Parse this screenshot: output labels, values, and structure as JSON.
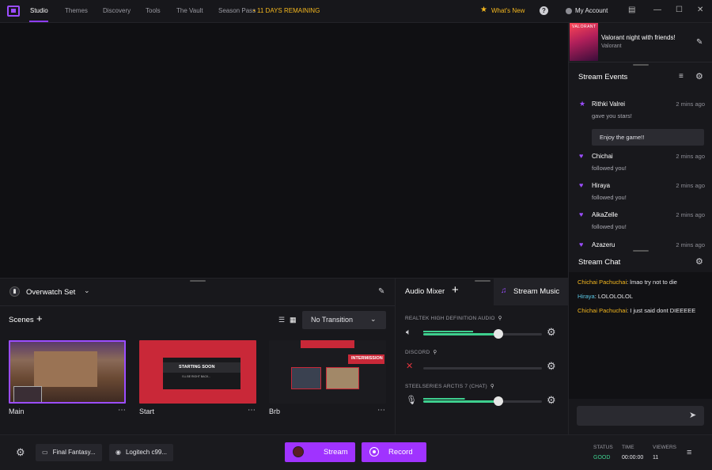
{
  "topbar": {
    "tabs": [
      "Studio",
      "Themes",
      "Discovery",
      "Tools",
      "The Vault",
      "Season Pass"
    ],
    "trial": "11 DAYS REMAINING",
    "whats_new": "What's New",
    "account": "My Account",
    "accent_color": "#9b4dff",
    "icons": [
      "app-logo-icon",
      "star-icon",
      "help-icon",
      "account-icon",
      "layout-icon",
      "minimize-icon",
      "maximize-icon",
      "close-icon"
    ]
  },
  "stream_info": {
    "thumb_text": "VALORANT",
    "title": "Valorant night with friends!",
    "game": "Valorant"
  },
  "events": {
    "title": "Stream Events",
    "items": [
      {
        "icon": "star",
        "name": "Rithki Valrei",
        "time": "2 mins ago",
        "message": "gave you stars!",
        "reply": "Enjoy the game!!"
      },
      {
        "icon": "heart",
        "name": "Chichai",
        "time": "2 mins ago",
        "message": "followed you!"
      },
      {
        "icon": "heart",
        "name": "Hiraya",
        "time": "2 mins ago",
        "message": "followed you!"
      },
      {
        "icon": "heart",
        "name": "AikaZelle",
        "time": "2 mins ago",
        "message": "followed you!"
      },
      {
        "icon": "heart",
        "name": "Azazeru",
        "time": "2 mins ago",
        "message": ""
      }
    ]
  },
  "chat": {
    "title": "Stream Chat",
    "messages": [
      {
        "user": "Chichai Pachuchai",
        "text": "lmao try not to die",
        "color": "#f5b81f"
      },
      {
        "user": "Hiraya",
        "text": "LOLOLOLOL",
        "color": "#5ac8e6"
      },
      {
        "user": "Chichai Pachuchai",
        "text": "I just said dont DIEEEEE",
        "color": "#f5b81f"
      }
    ]
  },
  "scene_collection": {
    "name": "Overwatch Set"
  },
  "scenes": {
    "title": "Scenes",
    "transition": "No Transition",
    "items": [
      {
        "name": "Main",
        "selected": true
      },
      {
        "name": "Start",
        "overlay_text": "STARTING SOON",
        "overlay_sub": "I'LL BE RIGHT BACK...",
        "selected": false
      },
      {
        "name": "Brb",
        "overlay_text": "INTERMISSION",
        "selected": false
      }
    ]
  },
  "audio": {
    "tab_mixer": "Audio Mixer",
    "tab_music": "Stream Music",
    "devices": [
      {
        "name": "REALTEK HIGH DEFINITION AUDIO",
        "icon": "speaker",
        "muted": false,
        "volume": 0.63,
        "level": 0.42
      },
      {
        "name": "DISCORD",
        "icon": "mic",
        "muted": true,
        "volume": 0,
        "level": 0
      },
      {
        "name": "STEELSERIES ARCTIS 7 (CHAT)",
        "icon": "mic",
        "muted": false,
        "volume": 0.63,
        "level": 0.35
      }
    ]
  },
  "bottom": {
    "sources": [
      {
        "icon": "window",
        "label": "Final Fantasy..."
      },
      {
        "icon": "camera",
        "label": "Logitech c99..."
      }
    ],
    "stream_label": "Stream",
    "record_label": "Record",
    "status_label": "STATUS",
    "status_value": "GOOD",
    "time_label": "TIME",
    "time_value": "00:00:00",
    "viewers_label": "VIEWERS",
    "viewers_value": "11"
  }
}
